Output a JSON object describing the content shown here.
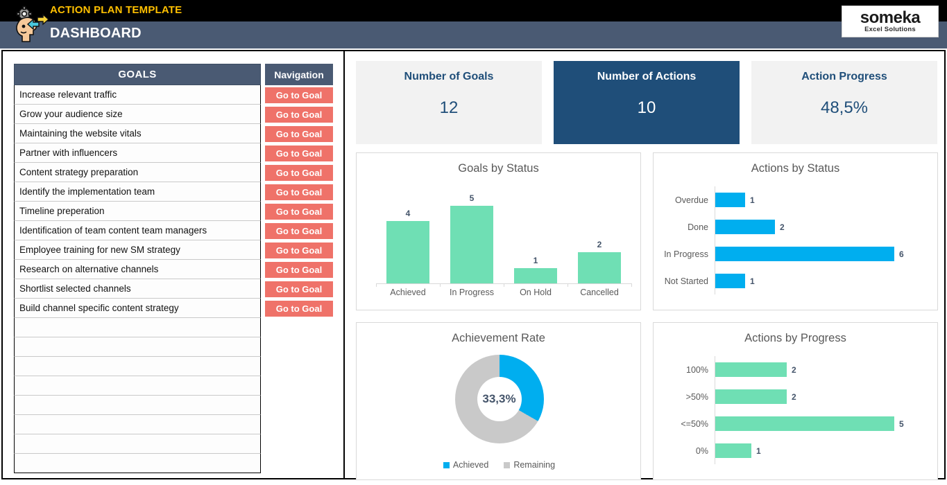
{
  "header": {
    "template_title": "ACTION PLAN TEMPLATE",
    "page_title": "DASHBOARD",
    "icon": "strategy-head-gear-icon",
    "logo_word": "someka",
    "logo_sub": "Excel Solutions",
    "colors": {
      "top_band": "#000000",
      "title_band": "#4A5A73",
      "accent_yellow": "#FFC000"
    }
  },
  "goals_table": {
    "goals_header": "GOALS",
    "navigation_header": "Navigation",
    "goto_label": "Go to Goal",
    "goto_color": "#EF7269",
    "rows": [
      "Increase relevant traffic",
      "Grow your audience size",
      "Maintaining the website vitals",
      "Partner with influencers",
      "Content strategy preparation",
      "Identify the implementation team",
      "Timeline preperation",
      "Identification of team content team managers",
      "Employee training for new SM strategy",
      "Research on alternative channels",
      "Shortlist selected channels",
      "Build channel specific content strategy"
    ],
    "empty_rows": 8
  },
  "kpis": [
    {
      "label": "Number of Goals",
      "value": "12",
      "highlight": false
    },
    {
      "label": "Number of Actions",
      "value": "10",
      "highlight": true
    },
    {
      "label": "Action Progress",
      "value": "48,5%",
      "highlight": false
    }
  ],
  "chart_data": [
    {
      "type": "bar",
      "orientation": "vertical",
      "title": "Goals by Status",
      "categories": [
        "Achieved",
        "In Progress",
        "On Hold",
        "Cancelled"
      ],
      "values": [
        4,
        5,
        1,
        2
      ],
      "ylim": [
        0,
        5
      ],
      "grid": false,
      "legend": "none",
      "series_color": "#6FDFB4",
      "label_color": "#44546A",
      "xlabel": "",
      "ylabel": ""
    },
    {
      "type": "bar",
      "orientation": "horizontal",
      "title": "Actions by Status",
      "categories": [
        "Overdue",
        "Done",
        "In Progress",
        "Not Started"
      ],
      "values": [
        1,
        2,
        6,
        1
      ],
      "xlim": [
        0,
        6
      ],
      "grid": false,
      "legend": "none",
      "series_color": "#00AEEF",
      "label_color": "#44546A",
      "xlabel": "",
      "ylabel": ""
    },
    {
      "type": "pie",
      "subtype": "donut",
      "title": "Achievement Rate",
      "center_label": "33,3%",
      "labels": [
        "Achieved",
        "Remaining"
      ],
      "values": [
        33.3,
        66.7
      ],
      "colors": [
        "#00AEEF",
        "#C9C9C9"
      ],
      "legend": "bottom",
      "start_angle_deg": 0
    },
    {
      "type": "bar",
      "orientation": "horizontal",
      "title": "Actions by Progress",
      "categories": [
        "100%",
        ">50%",
        "<=50%",
        "0%"
      ],
      "values": [
        2,
        2,
        5,
        1
      ],
      "xlim": [
        0,
        5
      ],
      "grid": false,
      "legend": "none",
      "series_color": "#6FDFB4",
      "label_color": "#44546A",
      "xlabel": "",
      "ylabel": ""
    }
  ]
}
